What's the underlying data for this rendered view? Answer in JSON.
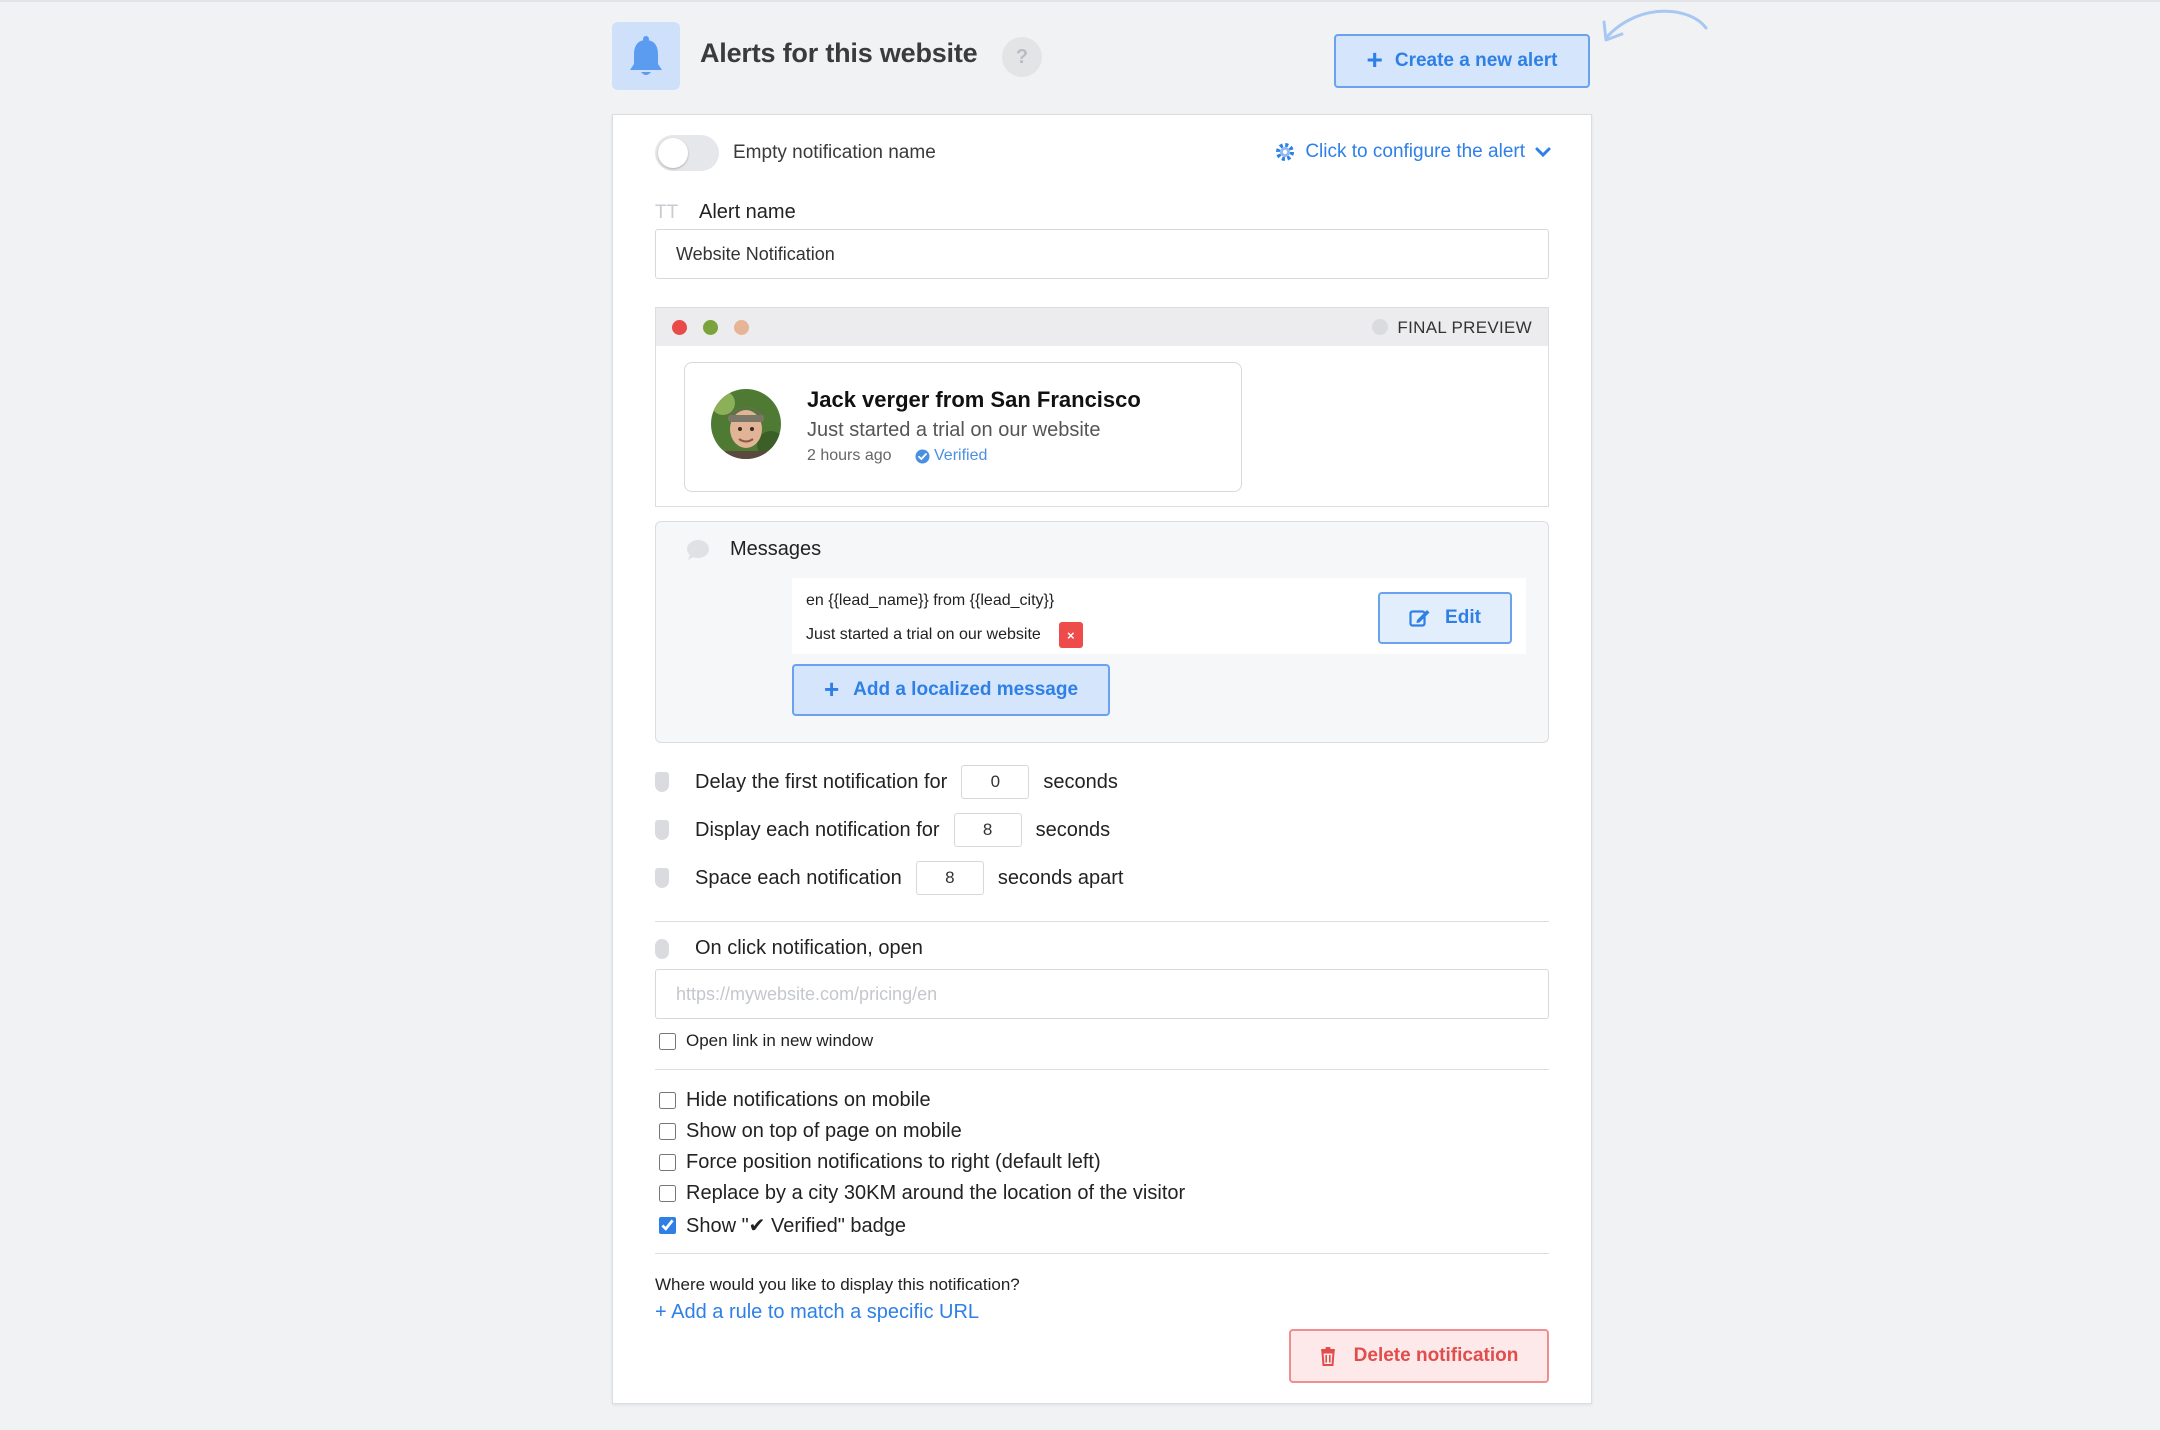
{
  "header": {
    "title": "Alerts for this website",
    "help_icon": "?",
    "create_button": "Create a new alert",
    "create_plus": "+"
  },
  "alert": {
    "toggle_label": "Empty notification name",
    "configure_link": "Click to configure the alert",
    "name_label": "Alert name",
    "name_icon": "TT",
    "name_value": "Website Notification"
  },
  "preview": {
    "label": "FINAL PREVIEW",
    "dots": [
      "#e94b4b",
      "#7aa33e",
      "#e6b597"
    ],
    "notification": {
      "title": "Jack verger from San Francisco",
      "subtitle": "Just started a trial on our website",
      "time": "2 hours ago",
      "verified": "Verified"
    }
  },
  "messages": {
    "title": "Messages",
    "line1": "en {{lead_name}} from {{lead_city}}",
    "line2": "Just started a trial on our website",
    "delete_x": "×",
    "edit_button": "Edit",
    "add_localized": "Add a localized message",
    "add_plus": "+"
  },
  "timing": {
    "delay_label": "Delay the first notification for",
    "delay_value": "0",
    "delay_unit": "seconds",
    "display_label": "Display each notification for",
    "display_value": "8",
    "display_unit": "seconds",
    "space_label": "Space each notification",
    "space_value": "8",
    "space_unit": "seconds apart"
  },
  "onclick": {
    "label": "On click notification, open",
    "url_placeholder": "https://mywebsite.com/pricing/en",
    "new_window_label": "Open link in new window"
  },
  "options": [
    {
      "label": "Hide notifications on mobile",
      "checked": false
    },
    {
      "label": "Show on top of page on mobile",
      "checked": false
    },
    {
      "label": "Force position notifications to right (default left)",
      "checked": false
    },
    {
      "label": "Replace by a city 30KM around the location of the visitor",
      "checked": false
    },
    {
      "label": "Show \"✔ Verified\" badge",
      "checked": true
    }
  ],
  "display_rules": {
    "question": "Where would you like to display this notification?",
    "add_rule": "+ Add a rule to match a specific URL"
  },
  "delete_button": "Delete notification",
  "colors": {
    "accent": "#2e80e7",
    "danger": "#e14c4c",
    "page_bg": "#f1f2f4"
  }
}
